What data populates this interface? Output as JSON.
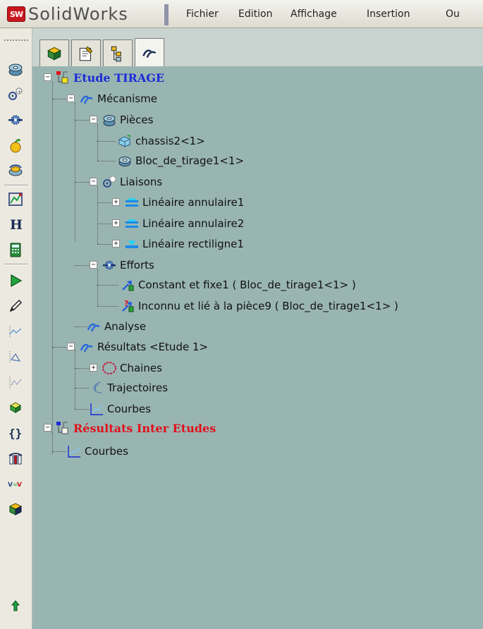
{
  "app": {
    "brand_short": "SW",
    "brand_name": "SolidWorks"
  },
  "menu": [
    "Fichier",
    "Edition",
    "Affichage",
    "Insertion",
    "Ou"
  ],
  "toolbar": {
    "buttons": [
      "part-gear-icon",
      "mate-icon",
      "gear-link-icon",
      "apple-icon",
      "rotate-gear-icon",
      "graph-icon",
      "h-icon",
      "calculator-icon",
      "play-icon",
      "pencil-icon",
      "curve-icon",
      "trajectory-icon",
      "curves-icon",
      "part-icon",
      "braces-icon",
      "pillars-icon",
      "ratio-icon",
      "block-icon",
      "up-arrow-icon"
    ]
  },
  "tabs": [
    "feature-manager-tab",
    "property-manager-tab",
    "config-manager-tab",
    "meca-tab"
  ],
  "tree": {
    "study": "Etude TIRAGE",
    "mechanism": "Mécanisme",
    "parts": "Pièces",
    "part1": "chassis2<1>",
    "part2": "Bloc_de_tirage1<1>",
    "links": "Liaisons",
    "link1": "Linéaire annulaire1",
    "link2": "Linéaire annulaire2",
    "link3": "Linéaire rectiligne1",
    "efforts": "Efforts",
    "effort1": "Constant et fixe1 ( Bloc_de_tirage1<1> )",
    "effort2": "Inconnu et lié à la pièce9 ( Bloc_de_tirage1<1> )",
    "analysis": "Analyse",
    "results": "Résultats <Etude 1>",
    "chains": "Chaines",
    "trajectories": "Trajectoires",
    "curves": "Courbes",
    "inter_results": "Résultats Inter Etudes",
    "inter_curves": "Courbes"
  }
}
